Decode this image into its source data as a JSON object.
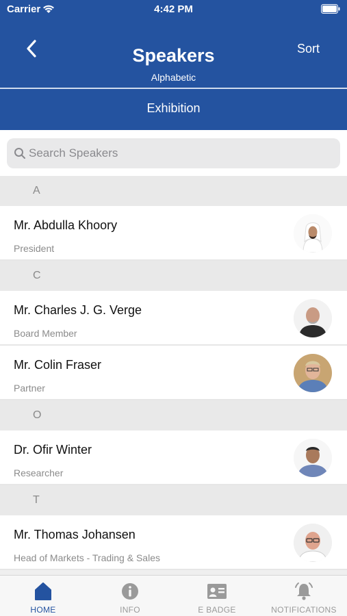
{
  "status_bar": {
    "carrier": "Carrier",
    "time": "4:42 PM"
  },
  "header": {
    "title": "Speakers",
    "subtitle": "Alphabetic",
    "sort_label": "Sort",
    "segment_label": "Exhibition"
  },
  "search": {
    "placeholder": "Search Speakers",
    "value": ""
  },
  "sections": [
    {
      "letter": "A",
      "speakers": [
        {
          "name": "Mr. Abdulla Khoory",
          "role": "President"
        }
      ]
    },
    {
      "letter": "C",
      "speakers": [
        {
          "name": "Mr. Charles J. G. Verge",
          "role": "Board Member"
        },
        {
          "name": "Mr. Colin Fraser",
          "role": "Partner"
        }
      ]
    },
    {
      "letter": "O",
      "speakers": [
        {
          "name": "Dr. Ofir Winter",
          "role": "Researcher"
        }
      ]
    },
    {
      "letter": "T",
      "speakers": [
        {
          "name": "Mr. Thomas Johansen",
          "role": "Head of Markets - Trading & Sales"
        }
      ]
    }
  ],
  "tabs": [
    {
      "label": "HOME",
      "icon": "home-icon",
      "active": true
    },
    {
      "label": "INFO",
      "icon": "info-icon",
      "active": false
    },
    {
      "label": "E BADGE",
      "icon": "badge-icon",
      "active": false
    },
    {
      "label": "NOTIFICATIONS",
      "icon": "bell-icon",
      "active": false
    }
  ],
  "colors": {
    "brand": "#2453a0",
    "inactive_tab": "#9a9a9a",
    "section_bg": "#e9e9e9"
  }
}
